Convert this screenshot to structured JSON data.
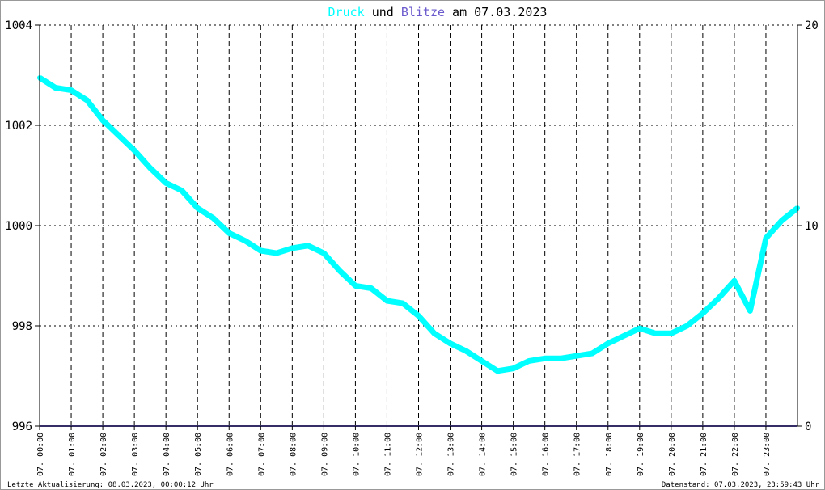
{
  "chart_data": {
    "type": "line",
    "title_parts": [
      {
        "text": "Druck",
        "color": "#00ffff"
      },
      {
        "text": " und ",
        "color": "#000000"
      },
      {
        "text": "Blitze",
        "color": "#6a5acd"
      },
      {
        "text": " am 07.03.2023",
        "color": "#000000"
      }
    ],
    "y_left": {
      "min": 996,
      "max": 1004,
      "ticks": [
        996,
        998,
        1000,
        1002,
        1004
      ]
    },
    "y_right": {
      "min": 0,
      "max": 20,
      "ticks": [
        0,
        10,
        20
      ]
    },
    "x_range_hours": [
      0,
      24
    ],
    "x_ticks": [
      "07. 00:00",
      "07. 01:00",
      "07. 02:00",
      "07. 03:00",
      "07. 04:00",
      "07. 05:00",
      "07. 06:00",
      "07. 07:00",
      "07. 08:00",
      "07. 09:00",
      "07. 10:00",
      "07. 11:00",
      "07. 12:00",
      "07. 13:00",
      "07. 14:00",
      "07. 15:00",
      "07. 16:00",
      "07. 17:00",
      "07. 18:00",
      "07. 19:00",
      "07. 20:00",
      "07. 21:00",
      "07. 22:00",
      "07. 23:00"
    ],
    "grid": true,
    "series": [
      {
        "name": "Druck",
        "color": "#00ffff",
        "axis": "left",
        "x_hours": [
          0,
          0.5,
          1,
          1.5,
          2,
          2.5,
          3,
          3.5,
          4,
          4.5,
          5,
          5.5,
          6,
          6.5,
          7,
          7.5,
          8,
          8.5,
          9,
          9.5,
          10,
          10.5,
          11,
          11.5,
          12,
          12.5,
          13,
          13.5,
          14,
          14.5,
          15,
          15.5,
          16,
          16.5,
          17,
          17.5,
          18,
          18.5,
          19,
          19.5,
          20,
          20.5,
          21,
          21.5,
          22,
          22.5,
          23,
          23.5,
          24
        ],
        "values": [
          1002.95,
          1002.75,
          1002.7,
          1002.5,
          1002.1,
          1001.8,
          1001.5,
          1001.15,
          1000.85,
          1000.7,
          1000.35,
          1000.15,
          999.85,
          999.7,
          999.5,
          999.45,
          999.55,
          999.6,
          999.45,
          999.1,
          998.8,
          998.75,
          998.5,
          998.45,
          998.2,
          997.85,
          997.65,
          997.5,
          997.3,
          997.1,
          997.15,
          997.3,
          997.35,
          997.35,
          997.4,
          997.45,
          997.65,
          997.8,
          997.95,
          997.85,
          997.85,
          998.0,
          998.25,
          998.55,
          998.9,
          998.3,
          999.75,
          1000.1,
          1000.35
        ]
      },
      {
        "name": "Blitze",
        "color": "#6a5acd",
        "axis": "right",
        "x_hours": [
          0,
          24
        ],
        "values": [
          0,
          0
        ]
      }
    ]
  },
  "footer": {
    "left": "Letzte Aktualisierung: 08.03.2023, 00:00:12 Uhr",
    "right": "Datenstand: 07.03.2023, 23:59:43 Uhr"
  }
}
